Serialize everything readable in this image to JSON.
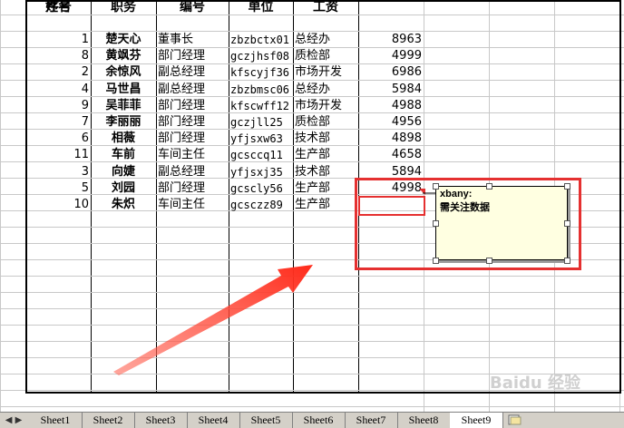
{
  "headers": [
    "序号",
    "姓名",
    "职务",
    "编号",
    "单位",
    "工资"
  ],
  "rows": [
    {
      "seq": "1",
      "name": "楚天心",
      "title": "董事长",
      "code": "zbzbctx01",
      "unit": "总经办",
      "salary": "8963"
    },
    {
      "seq": "8",
      "name": "黄飒芬",
      "title": "部门经理",
      "code": "gczjhsf08",
      "unit": "质检部",
      "salary": "4999"
    },
    {
      "seq": "2",
      "name": "余惊风",
      "title": "副总经理",
      "code": "kfscyjf36",
      "unit": "市场开发",
      "salary": "6986"
    },
    {
      "seq": "4",
      "name": "马世昌",
      "title": "副总经理",
      "code": "zbzbmsc06",
      "unit": "总经办",
      "salary": "5984"
    },
    {
      "seq": "9",
      "name": "吴菲菲",
      "title": "部门经理",
      "code": "kfscwff12",
      "unit": "市场开发",
      "salary": "4988"
    },
    {
      "seq": "7",
      "name": "李丽丽",
      "title": "部门经理",
      "code": "gczjll25",
      "unit": "质检部",
      "salary": "4956"
    },
    {
      "seq": "6",
      "name": "相薇",
      "title": "部门经理",
      "code": "yfjsxw63",
      "unit": "技术部",
      "salary": "4898"
    },
    {
      "seq": "11",
      "name": "车前",
      "title": "车间主任",
      "code": "gcsccq11",
      "unit": "生产部",
      "salary": "4658"
    },
    {
      "seq": "3",
      "name": "向婕",
      "title": "副总经理",
      "code": "yfjsxj35",
      "unit": "技术部",
      "salary": "5894"
    },
    {
      "seq": "5",
      "name": "刘园",
      "title": "部门经理",
      "code": "gcscly56",
      "unit": "生产部",
      "salary": "4998"
    },
    {
      "seq": "10",
      "name": "朱炽",
      "title": "车间主任",
      "code": "gcsczz89",
      "unit": "生产部",
      "salary": ""
    }
  ],
  "comment": {
    "author": "xbany:",
    "text": "需关注数据"
  },
  "sheet_tabs": [
    "Sheet1",
    "Sheet2",
    "Sheet3",
    "Sheet4",
    "Sheet5",
    "Sheet6",
    "Sheet7",
    "Sheet8",
    "Sheet9"
  ],
  "active_tab": "Sheet9",
  "watermark": "Baidu 经验",
  "colors": {
    "highlight": "#e53030",
    "comment_bg": "#ffffe1",
    "tab_bar": "#d4d0c8"
  }
}
